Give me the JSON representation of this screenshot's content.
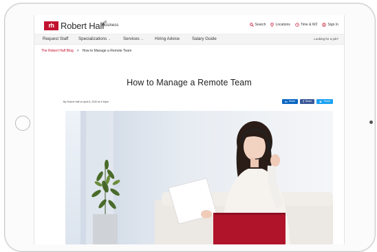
{
  "brand": {
    "logo_mark": "rh",
    "logo_text": "Robert Half",
    "trademark": "®",
    "section": "Business"
  },
  "utilities": [
    {
      "label": "Search",
      "icon": "search-icon"
    },
    {
      "label": "Locations",
      "icon": "location-pin-icon"
    },
    {
      "label": "Time & W2",
      "icon": "clock-icon"
    },
    {
      "label": "Sign In",
      "icon": "user-icon"
    }
  ],
  "nav": {
    "items": [
      {
        "label": "Request Staff"
      },
      {
        "label": "Specializations",
        "chevron": "⌄"
      },
      {
        "label": "Services",
        "chevron": "⌄"
      },
      {
        "label": "Hiring Advice"
      },
      {
        "label": "Salary Guide"
      }
    ],
    "right_link": "Looking for a job?"
  },
  "breadcrumb": {
    "parent": "The Robert Half Blog",
    "separator": ">",
    "current": "How to Manage a Remote Team"
  },
  "article": {
    "title": "How to Manage a Remote Team",
    "byline": "By Robert Half on April 8, 2020 at 4:30pm",
    "shares": [
      {
        "label": "Share",
        "icon": "linkedin-icon",
        "color": "#0a66c2"
      },
      {
        "label": "Share",
        "icon": "facebook-icon",
        "color": "#3b5998"
      },
      {
        "label": "Tweet",
        "icon": "twitter-icon",
        "color": "#1da1f2"
      }
    ]
  },
  "colors": {
    "brand_red": "#c1122f",
    "laptop_red": "#b0142a",
    "nav_bg": "#f4f4f4"
  }
}
